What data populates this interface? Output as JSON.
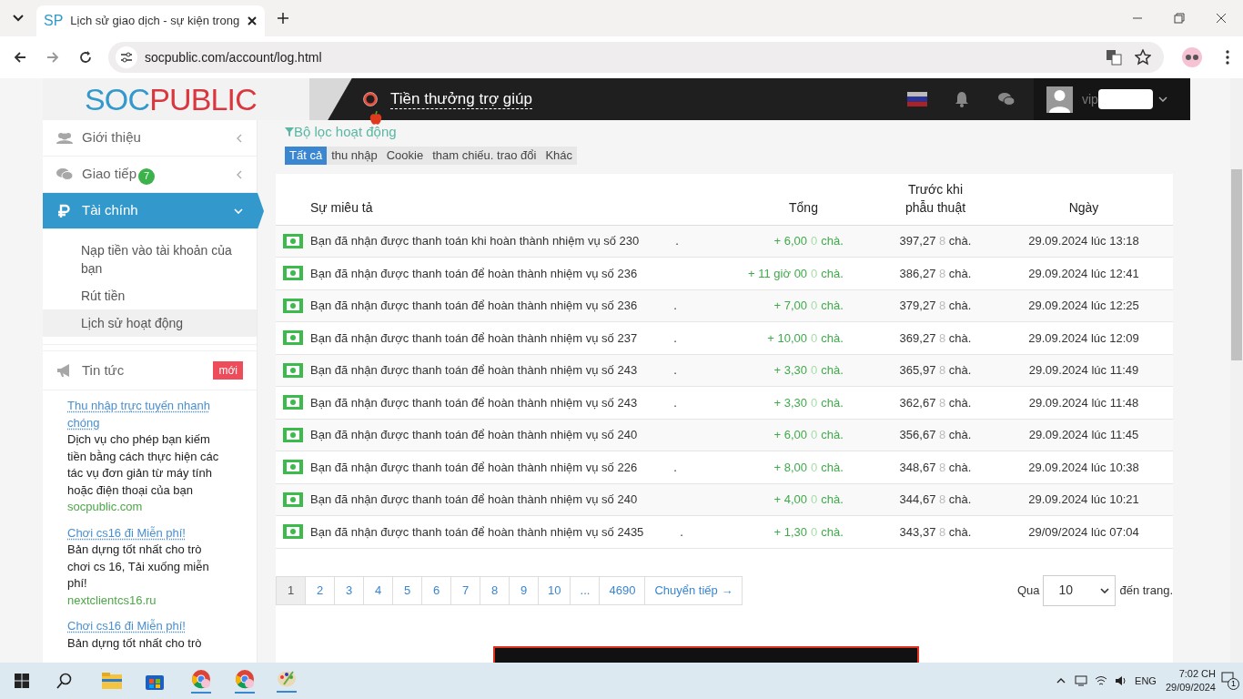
{
  "browser": {
    "tab_icon": "SP",
    "tab_title": "Lịch sử giao dịch - sự kiện trong",
    "url": "socpublic.com/account/log.html"
  },
  "header": {
    "logo_part1": "SOC",
    "logo_part2": "PUBLIC",
    "help_link": "Tiền thưởng trợ giúp",
    "username": "vip"
  },
  "sidebar": {
    "items": [
      {
        "label": "Giới thiệu",
        "expanded": false,
        "selected": false
      },
      {
        "label": "Giao tiếp",
        "badge": "7",
        "expanded": false,
        "selected": false
      },
      {
        "label": "Tài chính",
        "expanded": true,
        "selected": true,
        "children": [
          {
            "label": "Nạp tiền vào tài khoản của bạn",
            "selected": false
          },
          {
            "label": "Rút tiền",
            "selected": false
          },
          {
            "label": "Lịch sử hoạt động",
            "selected": true
          }
        ]
      }
    ],
    "news": {
      "label": "Tin tức",
      "badge": "mới"
    },
    "ads": [
      {
        "title": "Thu nhập trực tuyến nhanh chóng",
        "text": "Dịch vụ cho phép bạn kiếm tiền bằng cách thực hiện các tác vụ đơn giản từ máy tính hoặc điện thoại của bạn",
        "site": "socpublic.com"
      },
      {
        "title": "Chơi cs16 đi Miễn phí!",
        "text": "Bản dựng tốt nhất cho trò chơi cs 16, Tải xuống miễn phí!",
        "site": "nextclientcs16.ru"
      },
      {
        "title": "Chơi cs16 đi Miễn phí!",
        "text": "Bản dựng tốt nhất cho trò"
      }
    ]
  },
  "filter": {
    "title": "Bộ lọc hoạt động",
    "tabs": [
      {
        "label": "Tất cả",
        "selected": true
      },
      {
        "label": "thu nhập",
        "selected": false
      },
      {
        "label": "Cookie",
        "selected": false
      },
      {
        "label": "tham chiếu. trao đổi",
        "selected": false
      },
      {
        "label": "Khác",
        "selected": false
      }
    ]
  },
  "table": {
    "columns": [
      "Sự miêu tả",
      "Tổng",
      "Trước khi phẫu thuật",
      "Ngày"
    ],
    "rows": [
      {
        "description": "Bạn đã nhận được thanh toán khi hoàn thành nhiệm vụ số 230",
        "tail": ".",
        "amount": "+ 6,00",
        "amount_faded": "0",
        "amount_unit": "chà.",
        "before": "397,27",
        "before_faded": "8",
        "before_unit": "chà.",
        "date": "29.09.2024 lúc 13:18"
      },
      {
        "description": "Bạn đã nhận được thanh toán để hoàn thành nhiệm vụ số 236",
        "tail": "",
        "amount": "+ 11 giờ 00",
        "amount_faded": "0",
        "amount_unit": "chà.",
        "before": "386,27",
        "before_faded": "8",
        "before_unit": "chà.",
        "date": "29.09.2024 lúc 12:41"
      },
      {
        "description": "Bạn đã nhận được thanh toán để hoàn thành nhiệm vụ số 236",
        "tail": ".",
        "amount": "+ 7,00",
        "amount_faded": "0",
        "amount_unit": "chà.",
        "before": "379,27",
        "before_faded": "8",
        "before_unit": "chà.",
        "date": "29.09.2024 lúc 12:25"
      },
      {
        "description": "Bạn đã nhận được thanh toán để hoàn thành nhiệm vụ số 237",
        "tail": ".",
        "amount": "+ 10,00",
        "amount_faded": "0",
        "amount_unit": "chà.",
        "before": "369,27",
        "before_faded": "8",
        "before_unit": "chà.",
        "date": "29.09.2024 lúc 12:09"
      },
      {
        "description": "Bạn đã nhận được thanh toán để hoàn thành nhiệm vụ số 243",
        "tail": ".",
        "amount": "+ 3,30",
        "amount_faded": "0",
        "amount_unit": "chà.",
        "before": "365,97",
        "before_faded": "8",
        "before_unit": "chà.",
        "date": "29.09.2024 lúc 11:49"
      },
      {
        "description": "Bạn đã nhận được thanh toán để hoàn thành nhiệm vụ số 243",
        "tail": ".",
        "amount": "+ 3,30",
        "amount_faded": "0",
        "amount_unit": "chà.",
        "before": "362,67",
        "before_faded": "8",
        "before_unit": "chà.",
        "date": "29.09.2024 lúc 11:48"
      },
      {
        "description": "Bạn đã nhận được thanh toán để hoàn thành nhiệm vụ số 240",
        "tail": "",
        "amount": "+ 6,00",
        "amount_faded": "0",
        "amount_unit": "chà.",
        "before": "356,67",
        "before_faded": "8",
        "before_unit": "chà.",
        "date": "29.09.2024 lúc 11:45"
      },
      {
        "description": "Bạn đã nhận được thanh toán để hoàn thành nhiệm vụ số 226",
        "tail": ".",
        "amount": "+ 8,00",
        "amount_faded": "0",
        "amount_unit": "chà.",
        "before": "348,67",
        "before_faded": "8",
        "before_unit": "chà.",
        "date": "29.09.2024 lúc 10:38"
      },
      {
        "description": "Bạn đã nhận được thanh toán để hoàn thành nhiệm vụ số 240",
        "tail": "",
        "amount": "+ 4,00",
        "amount_faded": "0",
        "amount_unit": "chà.",
        "before": "344,67",
        "before_faded": "8",
        "before_unit": "chà.",
        "date": "29.09.2024 lúc 10:21"
      },
      {
        "description": "Bạn đã nhận được thanh toán để hoàn thành nhiệm vụ số 2435",
        "tail": ".",
        "amount": "+ 1,30",
        "amount_faded": "0",
        "amount_unit": "chà.",
        "before": "343,37",
        "before_faded": "8",
        "before_unit": "chà.",
        "date": "29/09/2024 lúc 07:04"
      }
    ]
  },
  "pagination": {
    "pages": [
      {
        "label": "1",
        "selected": true
      },
      {
        "label": "2",
        "selected": false
      },
      {
        "label": "3",
        "selected": false
      },
      {
        "label": "4",
        "selected": false
      },
      {
        "label": "5",
        "selected": false
      },
      {
        "label": "6",
        "selected": false
      },
      {
        "label": "7",
        "selected": false
      },
      {
        "label": "8",
        "selected": false
      },
      {
        "label": "9",
        "selected": false
      },
      {
        "label": "10",
        "selected": false
      },
      {
        "label": "...",
        "selected": false
      },
      {
        "label": "4690",
        "selected": false
      },
      {
        "label": "Chuyển tiếp →",
        "selected": false
      }
    ],
    "per_page_label": "Qua",
    "per_page": "10",
    "per_page_suffix": "đến trang."
  },
  "taskbar": {
    "language": "ENG",
    "time": "7:02 CH",
    "date": "29/09/2024",
    "notifications": "1"
  }
}
